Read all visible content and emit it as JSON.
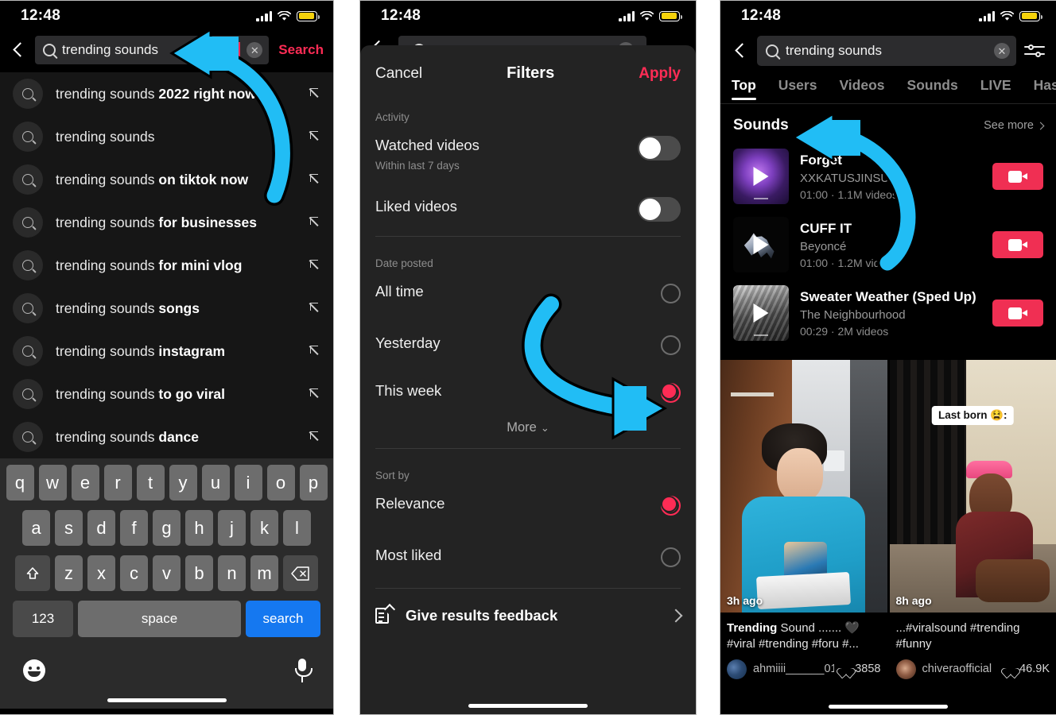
{
  "status_bar": {
    "time": "12:48",
    "wifi_icon": "wifi-icon",
    "signal_icon": "signal-icon",
    "battery_icon": "battery-icon"
  },
  "panel1": {
    "search": {
      "value": "trending sounds",
      "placeholder": "Search",
      "search_button": "Search",
      "search_icon": "search-icon",
      "clear_icon": "clear-icon",
      "back_icon": "back-chevron-icon"
    },
    "suggestions": [
      {
        "prefix": "trending sounds ",
        "bold": "2022 right now"
      },
      {
        "prefix": "trending sounds",
        "bold": ""
      },
      {
        "prefix": "trending sounds ",
        "bold": "on tiktok now"
      },
      {
        "prefix": "trending sounds ",
        "bold": "for businesses"
      },
      {
        "prefix": "trending sounds ",
        "bold": "for mini vlog"
      },
      {
        "prefix": "trending sounds ",
        "bold": "songs"
      },
      {
        "prefix": "trending sounds ",
        "bold": "instagram"
      },
      {
        "prefix": "trending sounds ",
        "bold": "to go viral"
      },
      {
        "prefix": "trending sounds ",
        "bold": "dance"
      }
    ],
    "keyboard": {
      "row1": [
        "q",
        "w",
        "e",
        "r",
        "t",
        "y",
        "u",
        "i",
        "o",
        "p"
      ],
      "row2": [
        "a",
        "s",
        "d",
        "f",
        "g",
        "h",
        "j",
        "k",
        "l"
      ],
      "row3": [
        "z",
        "x",
        "c",
        "v",
        "b",
        "n",
        "m"
      ],
      "shift_icon": "shift-icon",
      "backspace_icon": "backspace-icon",
      "numbers_key": "123",
      "space_key": "space",
      "go_key": "search",
      "emoji_icon": "emoji-icon",
      "mic_icon": "microphone-icon"
    }
  },
  "panel2": {
    "header": {
      "cancel": "Cancel",
      "title": "Filters",
      "apply": "Apply"
    },
    "activity": {
      "label": "Activity",
      "items": [
        {
          "label": "Watched videos",
          "sublabel": "Within last 7 days",
          "on": false
        },
        {
          "label": "Liked videos",
          "sublabel": "",
          "on": false
        }
      ]
    },
    "date_posted": {
      "label": "Date posted",
      "options": [
        {
          "label": "All time",
          "selected": false
        },
        {
          "label": "Yesterday",
          "selected": false
        },
        {
          "label": "This week",
          "selected": true
        }
      ],
      "more": "More",
      "more_icon": "chevron-down-icon"
    },
    "sort_by": {
      "label": "Sort by",
      "options": [
        {
          "label": "Relevance",
          "selected": true
        },
        {
          "label": "Most liked",
          "selected": false
        }
      ]
    },
    "feedback": {
      "label": "Give results feedback",
      "icon": "feedback-icon",
      "chevron": "chevron-right-icon"
    }
  },
  "panel3": {
    "search": {
      "value": "trending sounds",
      "clear_icon": "clear-icon",
      "filter_icon": "filter-sliders-icon",
      "back_icon": "back-chevron-icon"
    },
    "tabs": [
      {
        "label": "Top",
        "active": true
      },
      {
        "label": "Users",
        "active": false
      },
      {
        "label": "Videos",
        "active": false
      },
      {
        "label": "Sounds",
        "active": false
      },
      {
        "label": "LIVE",
        "active": false
      },
      {
        "label": "Hashtag",
        "active": false
      }
    ],
    "sounds_section": {
      "title": "Sounds",
      "see_more": "See more",
      "items": [
        {
          "name": "Forget",
          "author": "XXKATUSJINSUX",
          "meta": "01:00 · 1.1M videos",
          "use_icon": "video-camera-icon"
        },
        {
          "name": "CUFF IT",
          "author": "Beyoncé",
          "meta": "01:00 · 1.2M videos",
          "use_icon": "video-camera-icon"
        },
        {
          "name": "Sweater Weather (Sped Up)",
          "author": "The Neighbourhood",
          "meta": "00:29 · 2M videos",
          "use_icon": "video-camera-icon"
        }
      ]
    },
    "videos": [
      {
        "time": "3h ago",
        "overlay": "",
        "caption_bold": "Trending",
        "caption_rest": " Sound ....... 🖤 #viral #trending #foru #...",
        "username": "ahmiiii______01",
        "likes": "3858"
      },
      {
        "time": "8h ago",
        "overlay": "Last born 😫:",
        "caption_bold": "",
        "caption_rest": "...#viralsound #trending #funny",
        "username": "chiveraofficial",
        "likes": "46.9K"
      }
    ]
  },
  "annotations": {
    "arrow_color": "#21bdf5",
    "arrows": [
      "arrow-to-search-field",
      "arrow-to-this-week-radio",
      "arrow-to-sounds-section"
    ]
  },
  "colors": {
    "accent_red": "#fe2c55",
    "use_button": "#f02f53",
    "keyboard_go": "#1578f0",
    "battery": "#f5d20c"
  }
}
